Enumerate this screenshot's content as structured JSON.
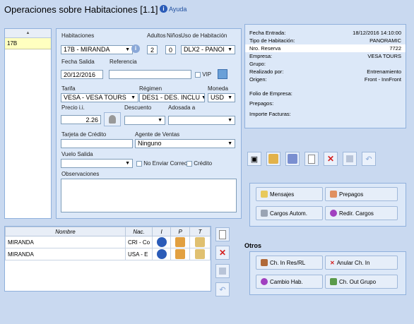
{
  "header": {
    "title": "Operaciones sobre Habitaciones [1.1]",
    "help_label": "Ayuda"
  },
  "room_list": {
    "sort_glyph": "▲",
    "items": [
      "17B"
    ]
  },
  "form": {
    "habitaciones_label": "Habitaciones",
    "habitacion_value": "17B - MIRANDA",
    "adultos_label": "Adultos",
    "ninos_label": "Niños",
    "uso_label": "Uso de Habitación",
    "adultos_value": "2",
    "ninos_value": "0",
    "uso_value": "DLX2 - PANOI",
    "fecha_salida_label": "Fecha Salida",
    "fecha_salida_value": "20/12/2016",
    "referencia_label": "Referencia",
    "referencia_value": "",
    "vip_label": "VIP",
    "tarifa_label": "Tarifa",
    "tarifa_value": "VESA - VESA TOURS",
    "regimen_label": "Régimen",
    "regimen_value": "DES1 - DES. INCLU",
    "moneda_label": "Moneda",
    "moneda_value": "USD",
    "precio_label": "Precio i.i.",
    "precio_value": "2.26",
    "descuento_label": "Descuento",
    "adosada_label": "Adosada a",
    "tarjeta_label": "Tarjeta de Crédito",
    "agente_label": "Agente de Ventas",
    "agente_value": "Ninguno",
    "vuelo_label": "Vuelo Salida",
    "no_enviar_label": "No Enviar Correo",
    "credito_label": "Crédito",
    "observaciones_label": "Observaciones"
  },
  "info": {
    "rows": [
      {
        "k": "Fecha Entrada:",
        "v": "18/12/2016 14:10:00"
      },
      {
        "k": "Tipo de Habitación:",
        "v": "PANORAMIC"
      },
      {
        "k": "Nro. Reserva",
        "v": "7722"
      },
      {
        "k": "Empresa:",
        "v": "VESA TOURS"
      },
      {
        "k": "Grupo:",
        "v": ""
      },
      {
        "k": "Realizado por:",
        "v": "Entrenamiento"
      },
      {
        "k": "Origen:",
        "v": "Front - InnFront"
      }
    ],
    "folio_label": "Folio de Empresa:",
    "prepagos_label": "Prepagos:",
    "importe_label": "Importe Facturas:"
  },
  "guests": {
    "headers": [
      "Nombre",
      "Nac.",
      "I",
      "P",
      "T"
    ],
    "rows": [
      {
        "nombre": "MIRANDA",
        "nac": "CRI - Co"
      },
      {
        "nombre": "MIRANDA",
        "nac": "USA - E"
      }
    ]
  },
  "actions": {
    "mensajes": "Mensajes",
    "prepagos": "Prepagos",
    "cargos_autom": "Cargos Autom.",
    "redir_cargos": "Redir. Cargos"
  },
  "otros": {
    "title": "Otros",
    "ch_in_res": "Ch. In Res/RL",
    "anular_ch_in": "Anular Ch. In",
    "cambio_hab": "Cambio Hab.",
    "ch_out_grupo": "Ch. Out Grupo"
  },
  "colors": {
    "accent": "#2a5bb8",
    "panel_border": "#8fb0dc",
    "selection": "#ffffc0",
    "delete_red": "#d42020"
  }
}
